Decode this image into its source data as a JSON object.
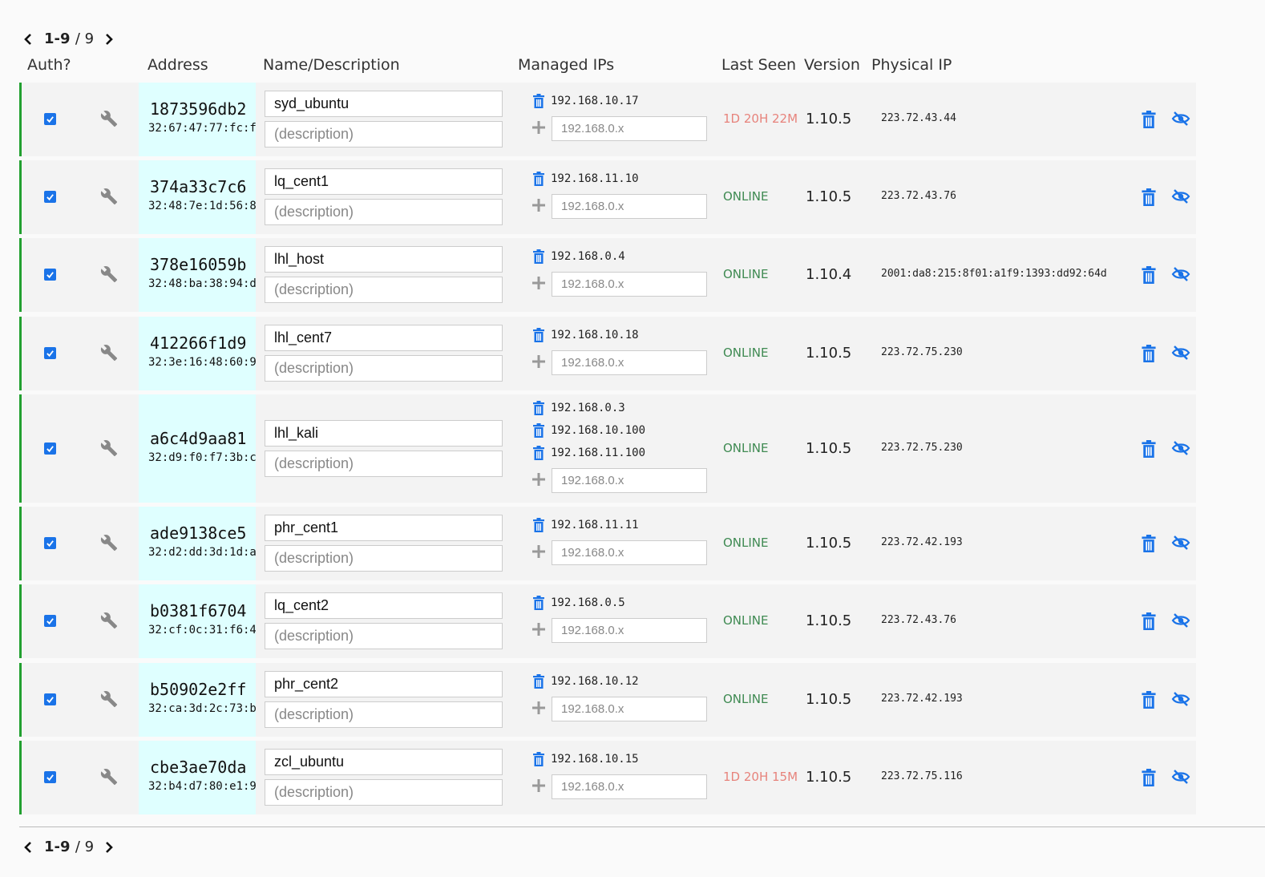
{
  "pager_top": {
    "range": "1-9",
    "total": "/ 9"
  },
  "pager_bottom": {
    "range": "1-9",
    "total": "/ 9"
  },
  "headers": {
    "auth": "Auth?",
    "address": "Address",
    "name": "Name/Description",
    "managed_ips": "Managed IPs",
    "last_seen": "Last Seen",
    "version": "Version",
    "physical_ip": "Physical IP"
  },
  "colors": {
    "accent": "#1a73e8",
    "online": "#3f8a52",
    "offline": "#e7837c",
    "address_bg": "#dfffff",
    "row_border": "#22a030"
  },
  "ip_placeholder": "192.168.0.x",
  "desc_placeholder": "(description)",
  "members": [
    {
      "authorized": true,
      "id": "1873596db2",
      "mac": "32:67:47:77:fc:f",
      "name": "syd_ubuntu",
      "ips": [
        "192.168.10.17"
      ],
      "last_seen": "1D 20H 22M",
      "online": false,
      "version": "1.10.5",
      "physical_ip": "223.72.43.44"
    },
    {
      "authorized": true,
      "id": "374a33c7c6",
      "mac": "32:48:7e:1d:56:8",
      "name": "lq_cent1",
      "ips": [
        "192.168.11.10"
      ],
      "last_seen": "ONLINE",
      "online": true,
      "version": "1.10.5",
      "physical_ip": "223.72.43.76"
    },
    {
      "authorized": true,
      "id": "378e16059b",
      "mac": "32:48:ba:38:94:d",
      "name": "lhl_host",
      "ips": [
        "192.168.0.4"
      ],
      "last_seen": "ONLINE",
      "online": true,
      "version": "1.10.4",
      "physical_ip": "2001:da8:215:8f01:a1f9:1393:dd92:64d"
    },
    {
      "authorized": true,
      "id": "412266f1d9",
      "mac": "32:3e:16:48:60:9",
      "name": "lhl_cent7",
      "ips": [
        "192.168.10.18"
      ],
      "last_seen": "ONLINE",
      "online": true,
      "version": "1.10.5",
      "physical_ip": "223.72.75.230"
    },
    {
      "authorized": true,
      "id": "a6c4d9aa81",
      "mac": "32:d9:f0:f7:3b:c",
      "name": "lhl_kali",
      "ips": [
        "192.168.0.3",
        "192.168.10.100",
        "192.168.11.100"
      ],
      "last_seen": "ONLINE",
      "online": true,
      "version": "1.10.5",
      "physical_ip": "223.72.75.230"
    },
    {
      "authorized": true,
      "id": "ade9138ce5",
      "mac": "32:d2:dd:3d:1d:a",
      "name": "phr_cent1",
      "ips": [
        "192.168.11.11"
      ],
      "last_seen": "ONLINE",
      "online": true,
      "version": "1.10.5",
      "physical_ip": "223.72.42.193"
    },
    {
      "authorized": true,
      "id": "b0381f6704",
      "mac": "32:cf:0c:31:f6:4",
      "name": "lq_cent2",
      "ips": [
        "192.168.0.5"
      ],
      "last_seen": "ONLINE",
      "online": true,
      "version": "1.10.5",
      "physical_ip": "223.72.43.76"
    },
    {
      "authorized": true,
      "id": "b50902e2ff",
      "mac": "32:ca:3d:2c:73:b",
      "name": "phr_cent2",
      "ips": [
        "192.168.10.12"
      ],
      "last_seen": "ONLINE",
      "online": true,
      "version": "1.10.5",
      "physical_ip": "223.72.42.193"
    },
    {
      "authorized": true,
      "id": "cbe3ae70da",
      "mac": "32:b4:d7:80:e1:9",
      "name": "zcl_ubuntu",
      "ips": [
        "192.168.10.15"
      ],
      "last_seen": "1D 20H 15M",
      "online": false,
      "version": "1.10.5",
      "physical_ip": "223.72.75.116"
    }
  ]
}
